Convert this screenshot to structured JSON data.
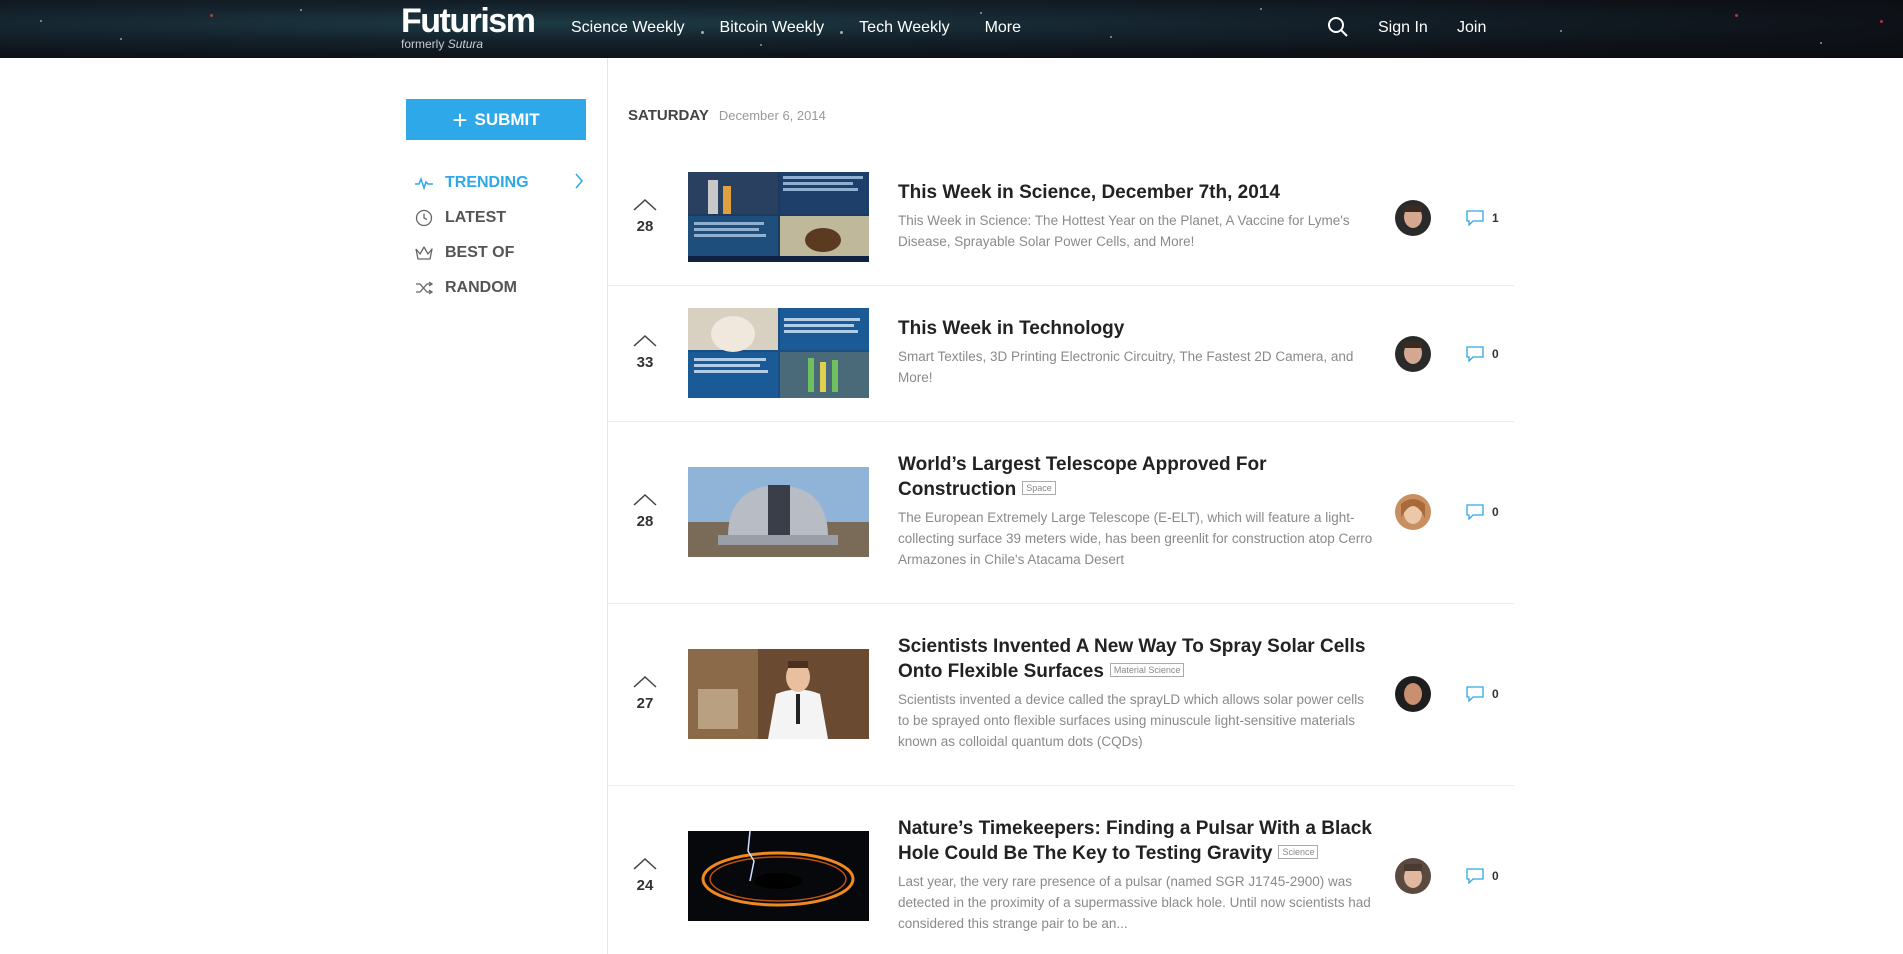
{
  "header": {
    "logo": "Futurism",
    "logo_sub_prefix": "formerly",
    "logo_sub_name": "Sutura",
    "nav": [
      "Science Weekly",
      "Bitcoin Weekly",
      "Tech Weekly",
      "More"
    ],
    "sign_in": "Sign In",
    "join": "Join",
    "search_icon": "search-icon"
  },
  "sidebar": {
    "submit_label": "SUBMIT",
    "items": [
      {
        "label": "TRENDING",
        "icon": "pulse-icon",
        "active": true
      },
      {
        "label": "LATEST",
        "icon": "clock-icon",
        "active": false
      },
      {
        "label": "BEST OF",
        "icon": "crown-icon",
        "active": false
      },
      {
        "label": "RANDOM",
        "icon": "shuffle-icon",
        "active": false
      }
    ]
  },
  "date": {
    "day": "SATURDAY",
    "full": "December 6, 2014"
  },
  "posts": [
    {
      "votes": "28",
      "title": "This Week in Science, December 7th, 2014",
      "tag": "",
      "desc": "This Week in Science: The Hottest Year on the Planet, A Vaccine for Lyme's Disease, Sprayable Solar Power Cells, and More!",
      "comments": "1"
    },
    {
      "votes": "33",
      "title": "This Week in Technology",
      "tag": "",
      "desc": "Smart Textiles, 3D Printing Electronic Circuitry, The Fastest 2D Camera, and More!",
      "comments": "0"
    },
    {
      "votes": "28",
      "title": "World’s Largest Telescope Approved For Construction",
      "tag": "Space",
      "desc": "The European Extremely Large Telescope (E-ELT), which will feature a light-collecting surface 39 meters wide, has been greenlit for construction atop Cerro Armazones in Chile's Atacama Desert",
      "comments": "0"
    },
    {
      "votes": "27",
      "title": "Scientists Invented A New Way To Spray Solar Cells Onto Flexible Surfaces",
      "tag": "Material Science",
      "desc": "Scientists invented a device called the sprayLD which allows solar power cells to be sprayed onto flexible surfaces using minuscule light-sensitive materials known as colloidal quantum dots (CQDs)",
      "comments": "0"
    },
    {
      "votes": "24",
      "title": "Nature’s Timekeepers: Finding a Pulsar With a Black Hole Could Be The Key to Testing Gravity",
      "tag": "Science",
      "desc": "Last year, the very rare presence of a pulsar (named SGR J1745-2900) was detected in the proximity of a supermassive black hole. Until now scientists had considered this strange pair to be an...",
      "comments": "0"
    }
  ],
  "colors": {
    "accent": "#2ea8e8",
    "title": "#222222",
    "desc": "#8a8a8a"
  }
}
